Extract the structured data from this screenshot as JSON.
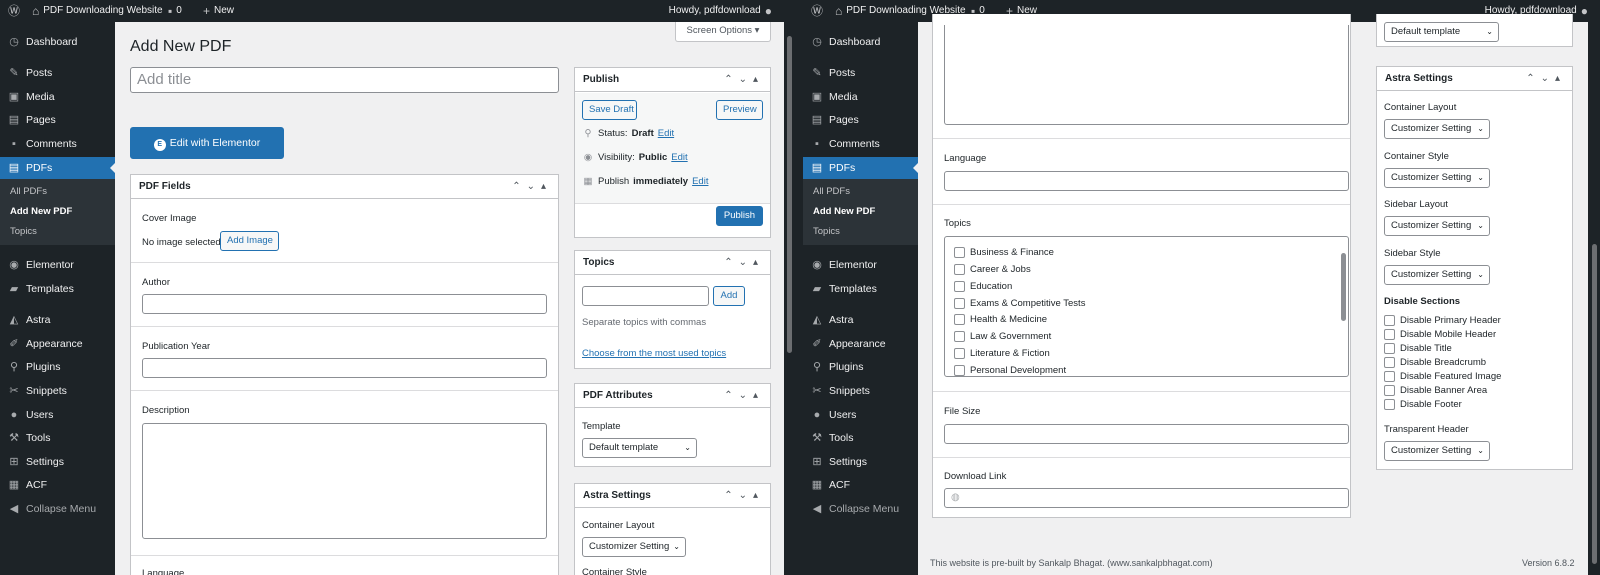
{
  "admin_bar": {
    "site_name": "PDF Downloading Website",
    "comments_count": "0",
    "new_label": "New",
    "howdy": "Howdy, pdfdownload"
  },
  "menu": {
    "items": [
      "Dashboard",
      "Posts",
      "Media",
      "Pages",
      "Comments",
      "PDFs",
      "Elementor",
      "Templates",
      "Astra",
      "Appearance",
      "Plugins",
      "Snippets",
      "Users",
      "Tools",
      "Settings",
      "ACF",
      "Collapse Menu"
    ],
    "sub_items": [
      "All PDFs",
      "Add New PDF",
      "Topics"
    ]
  },
  "page": {
    "title": "Add New PDF",
    "screen_options": "Screen Options",
    "title_placeholder": "Add title",
    "elementor_button": "Edit with Elementor",
    "elementor_icon": "E"
  },
  "pdf_fields": {
    "title": "PDF Fields",
    "cover_image_label": "Cover Image",
    "no_image": "No image selected",
    "add_image": "Add Image",
    "author_label": "Author",
    "year_label": "Publication Year",
    "description_label": "Description",
    "language_label": "Language",
    "topics_label": "Topics",
    "file_size_label": "File Size",
    "download_link_label": "Download Link"
  },
  "topics_list": [
    "Business & Finance",
    "Career & Jobs",
    "Education",
    "Exams & Competitive Tests",
    "Health & Medicine",
    "Law & Government",
    "Literature & Fiction",
    "Personal Development"
  ],
  "publish": {
    "title": "Publish",
    "save_draft": "Save Draft",
    "preview": "Preview",
    "status_label": "Status:",
    "status_value": "Draft",
    "visibility_label": "Visibility:",
    "visibility_value": "Public",
    "publish_label": "Publish",
    "publish_value": "immediately",
    "edit": "Edit",
    "publish_button": "Publish"
  },
  "topics_box": {
    "title": "Topics",
    "add": "Add",
    "hint": "Separate topics with commas",
    "choose": "Choose from the most used topics"
  },
  "attributes": {
    "title": "PDF Attributes",
    "template_label": "Template",
    "template_value": "Default template"
  },
  "astra": {
    "title": "Astra Settings",
    "container_layout": "Container Layout",
    "container_style": "Container Style",
    "sidebar_layout": "Sidebar Layout",
    "sidebar_style": "Sidebar Style",
    "customizer_setting": "Customizer Setting",
    "disable_sections": "Disable Sections",
    "disable_items": [
      "Disable Primary Header",
      "Disable Mobile Header",
      "Disable Title",
      "Disable Breadcrumb",
      "Disable Featured Image",
      "Disable Banner Area",
      "Disable Footer"
    ],
    "transparent_header": "Transparent Header"
  },
  "footer": {
    "credit": "This website is pre-built by Sankalp Bhagat. (www.sankalpbhagat.com)",
    "version": "Version 6.8.2"
  },
  "colors": {
    "admin_dark": "#1d2327",
    "accent": "#2271b1"
  }
}
